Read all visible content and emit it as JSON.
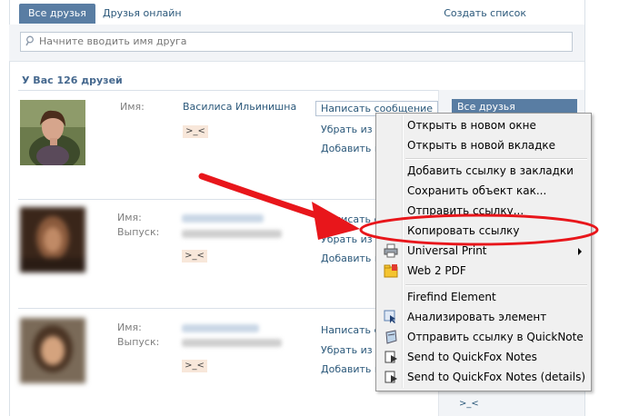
{
  "tabs": {
    "all": "Все друзья",
    "online": "Друзья онлайн",
    "create_list": "Создать список"
  },
  "search": {
    "placeholder": "Начните вводить имя друга"
  },
  "count": "У Вас 126 друзей",
  "friends": [
    {
      "name_label": "Имя:",
      "name": "Василиса Ильинишна",
      "badge": ">_<",
      "actions": [
        "Написать сообщение",
        "Убрать из д",
        "Добавить в"
      ]
    },
    {
      "name_label": "Имя:",
      "edu_label": "Выпуск:",
      "badge": ">_<",
      "actions": [
        "Написать с",
        "Убрать из д",
        "Добавить в"
      ]
    },
    {
      "name_label": "Имя:",
      "edu_label": "Выпуск:",
      "badge": ">_<",
      "actions": [
        "Написать сообщение",
        "Убрать из друзей",
        "Добавить в"
      ]
    }
  ],
  "right": {
    "button": "Все друзья",
    "tag": ">_<"
  },
  "context_menu": {
    "items": [
      {
        "label": "Открыть в новом окне"
      },
      {
        "label": "Открыть в новой вкладке"
      },
      {
        "label": "Добавить ссылку в закладки"
      },
      {
        "label": "Сохранить объект как..."
      },
      {
        "label": "Отправить ссылку..."
      },
      {
        "label": "Копировать ссылку"
      },
      {
        "label": "Universal Print",
        "icon": "printer-icon"
      },
      {
        "label": "Web 2 PDF",
        "icon": "folder-pdf-icon"
      },
      {
        "label": "Firefind Element"
      },
      {
        "label": "Анализировать элемент",
        "icon": "inspect-icon"
      },
      {
        "label": "Отправить ссылку в QuickNote",
        "icon": "quicknote-icon"
      },
      {
        "label": "Send to QuickFox Notes",
        "icon": "quickfox-icon"
      },
      {
        "label": "Send to QuickFox Notes (details)",
        "icon": "quickfox-icon"
      }
    ]
  },
  "colors": {
    "accent": "#597da3",
    "link": "#2b587a",
    "annotation": "#e8161b"
  }
}
